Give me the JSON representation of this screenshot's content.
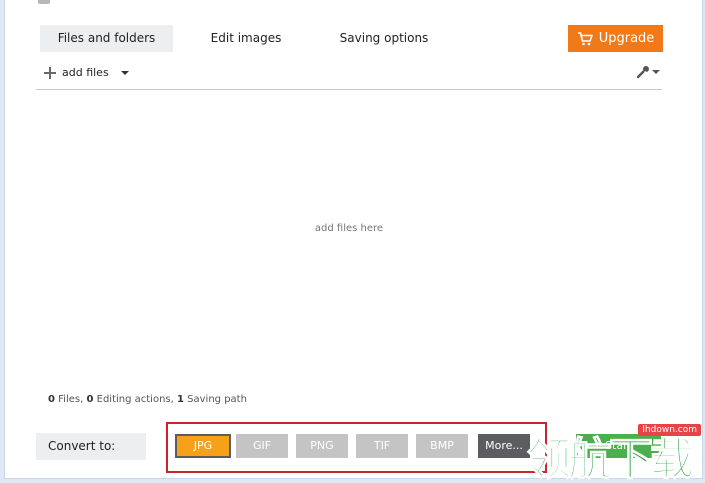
{
  "tabs": [
    {
      "label": "Files and folders",
      "active": true
    },
    {
      "label": "Edit images",
      "active": false
    },
    {
      "label": "Saving options",
      "active": false
    }
  ],
  "upgrade": {
    "label": "Upgrade",
    "icon": "cart-icon",
    "color": "#f07a19"
  },
  "toolbar": {
    "add_files_label": "add files",
    "add_icon": "plus-icon",
    "settings_icon": "wrench-icon"
  },
  "drop_zone": {
    "placeholder": "add files here"
  },
  "summary": {
    "files_count": "0",
    "files_label": "Files,",
    "editing_count": "0",
    "editing_label": "Editing actions,",
    "saving_count": "1",
    "saving_label": "Saving path"
  },
  "convert": {
    "label": "Convert to:",
    "formats": [
      "JPG",
      "GIF",
      "PNG",
      "TIF",
      "BMP"
    ],
    "selected": "JPG",
    "more_label": "More...",
    "start_label": "Start"
  },
  "watermark": {
    "text": "领航下载",
    "site": "lhdown.com"
  },
  "colors": {
    "accent": "#f07a19",
    "selected_format": "#f7a11a",
    "start": "#4cae4c",
    "highlight_box": "#c9252c"
  }
}
